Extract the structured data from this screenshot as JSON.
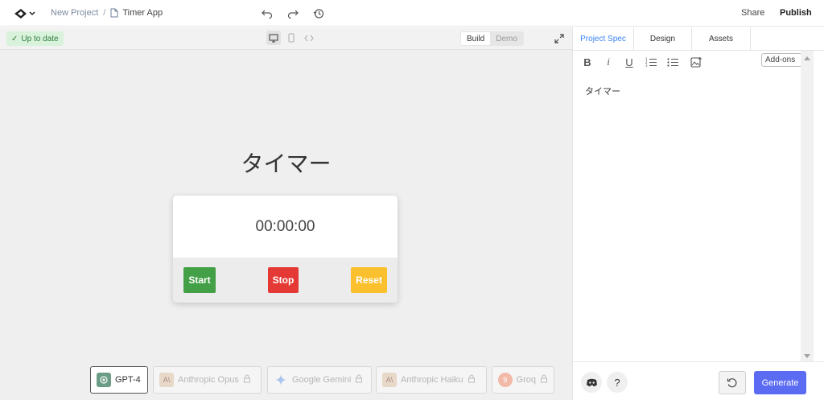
{
  "header": {
    "breadcrumb_root": "New Project",
    "breadcrumb_sep": "/",
    "file_name": "Timer App",
    "share_label": "Share",
    "publish_label": "Publish"
  },
  "canvas_toolbar": {
    "status": "Up to date",
    "modes": [
      "Build",
      "Demo"
    ],
    "active_mode": "Build"
  },
  "preview": {
    "title": "タイマー",
    "time": "00:00:00",
    "start_label": "Start",
    "stop_label": "Stop",
    "reset_label": "Reset",
    "colors": {
      "start": "#43a047",
      "stop": "#e53935",
      "reset": "#fbc02d"
    }
  },
  "models": [
    {
      "label": "GPT-4",
      "icon": "openai-icon",
      "locked": false,
      "selected": true
    },
    {
      "label": "Anthropic Opus",
      "icon": "anthropic-icon",
      "locked": true,
      "selected": false
    },
    {
      "label": "Google Gemini",
      "icon": "gemini-icon",
      "locked": true,
      "selected": false
    },
    {
      "label": "Anthropic Haiku",
      "icon": "anthropic-icon",
      "locked": true,
      "selected": false
    },
    {
      "label": "Groq",
      "icon": "groq-icon",
      "locked": true,
      "selected": false
    }
  ],
  "right_panel": {
    "tabs": [
      "Project Spec",
      "Design",
      "Assets"
    ],
    "active_tab": "Project Spec",
    "format_buttons": [
      "bold-icon",
      "italic-icon",
      "underline-icon",
      "ordered-list-icon",
      "bullet-list-icon",
      "image-icon"
    ],
    "addons_label": "Add-ons",
    "spec_text": "タイマー",
    "generate_label": "Generate",
    "help_label": "?"
  },
  "colors": {
    "accent": "#5b6cf2",
    "tab_active": "#3b82f6",
    "status_bg": "#d9f2dc"
  }
}
